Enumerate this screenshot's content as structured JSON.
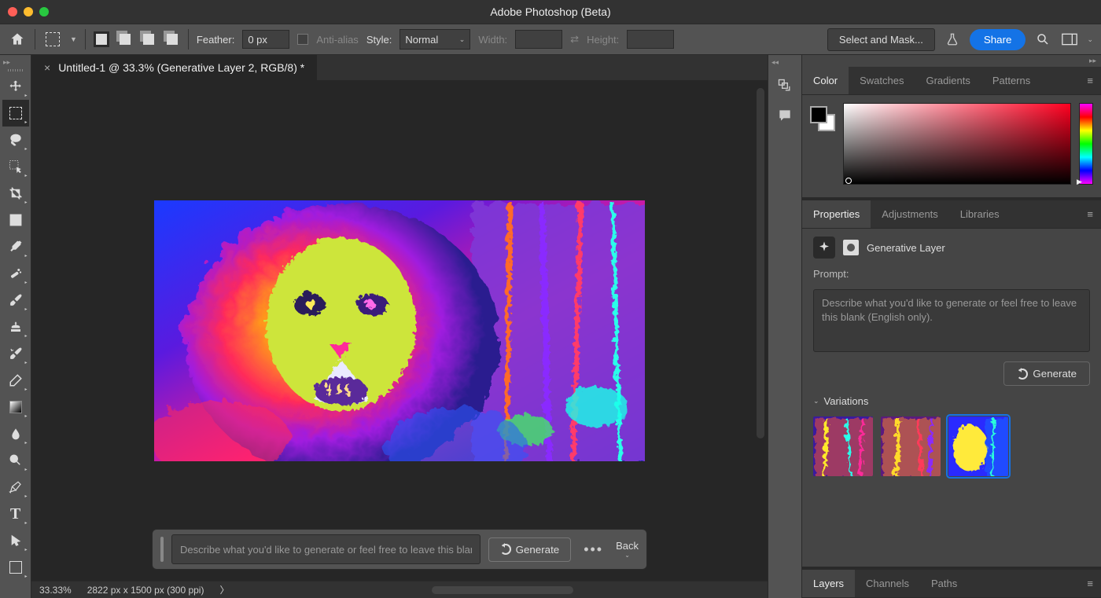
{
  "app_title": "Adobe Photoshop (Beta)",
  "optionsbar": {
    "feather_label": "Feather:",
    "feather_value": "0 px",
    "antialias_label": "Anti-alias",
    "style_label": "Style:",
    "style_value": "Normal",
    "width_label": "Width:",
    "height_label": "Height:",
    "select_mask": "Select and Mask...",
    "share": "Share"
  },
  "document": {
    "tab_title": "Untitled-1 @ 33.3% (Generative Layer 2, RGB/8) *"
  },
  "taskbar": {
    "placeholder": "Describe what you'd like to generate or feel free to leave this blank (English only).",
    "generate": "Generate",
    "back": "Back"
  },
  "statusbar": {
    "zoom": "33.33%",
    "dims": "2822 px x 1500 px (300 ppi)"
  },
  "right": {
    "color_tabs": [
      "Color",
      "Swatches",
      "Gradients",
      "Patterns"
    ],
    "props_tabs": [
      "Properties",
      "Adjustments",
      "Libraries"
    ],
    "layer_type": "Generative Layer",
    "prompt_label": "Prompt:",
    "prompt_placeholder": "Describe what you'd like to generate or feel free to leave this blank (English only).",
    "generate": "Generate",
    "variations_label": "Variations",
    "bottom_tabs": [
      "Layers",
      "Channels",
      "Paths"
    ]
  },
  "tools": [
    {
      "name": "move-tool"
    },
    {
      "name": "rectangular-marquee-tool",
      "active": true
    },
    {
      "name": "lasso-tool"
    },
    {
      "name": "object-selection-tool"
    },
    {
      "name": "crop-tool"
    },
    {
      "name": "frame-tool"
    },
    {
      "name": "eyedropper-tool"
    },
    {
      "name": "healing-brush-tool"
    },
    {
      "name": "brush-tool"
    },
    {
      "name": "clone-stamp-tool"
    },
    {
      "name": "history-brush-tool"
    },
    {
      "name": "eraser-tool"
    },
    {
      "name": "gradient-tool"
    },
    {
      "name": "blur-tool"
    },
    {
      "name": "dodge-tool"
    },
    {
      "name": "pen-tool"
    },
    {
      "name": "type-tool"
    },
    {
      "name": "path-selection-tool"
    },
    {
      "name": "rectangle-tool"
    }
  ],
  "colors": {
    "accent": "#1473e6"
  }
}
